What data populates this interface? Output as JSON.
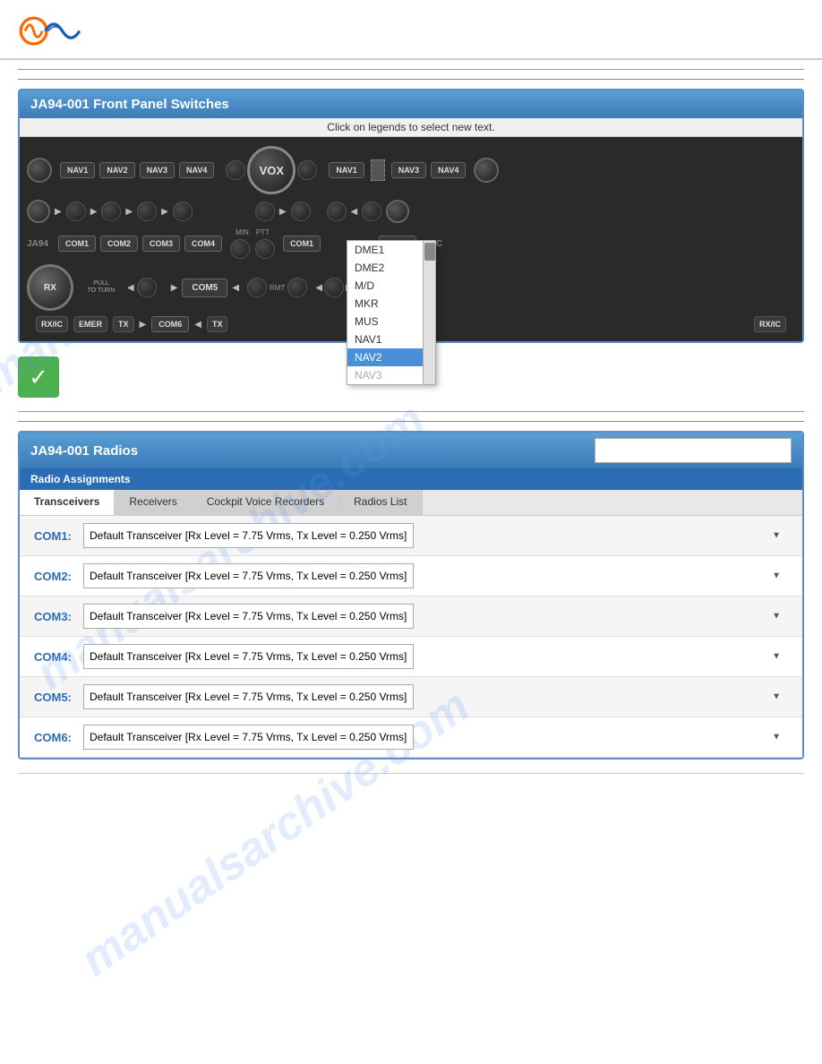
{
  "header": {
    "logo_alt": "Company Logo"
  },
  "panel1": {
    "title": "JA94-001 Front Panel Switches",
    "subtitle": "Click on legends to select new text.",
    "brand_left": "JA94",
    "brand_right": "JAC",
    "nav_buttons_top": [
      "NAV1",
      "NAV2",
      "NAV3",
      "NAV4",
      "NAV1",
      "NAV4"
    ],
    "com_buttons": [
      "COM1",
      "COM2",
      "COM3",
      "COM4",
      "COM1",
      "COM4"
    ],
    "bottom_buttons_left": [
      "RX/IC",
      "EMER",
      "TX",
      "COM6",
      "TX"
    ],
    "bottom_buttons_right": [
      "RX/IC"
    ],
    "vox_label": "VOX",
    "com5_label": "COM5",
    "rx_label": "RX",
    "pull_to_turn": "PULL\nTO TURN",
    "min_label": "MIN",
    "ptt_label": "PTT",
    "rmt_label": "RMT",
    "dropdown": {
      "items": [
        "DME1",
        "DME2",
        "M/D",
        "MKR",
        "MUS",
        "NAV1",
        "NAV2",
        "NAV3"
      ],
      "selected": "NAV2",
      "selected_index": 6
    }
  },
  "checkmark": {
    "symbol": "✓"
  },
  "panel2": {
    "title": "JA94-001 Radios",
    "assignments_label": "Radio Assignments",
    "tabs": [
      "Transceivers",
      "Receivers",
      "Cockpit Voice Recorders",
      "Radios List"
    ],
    "active_tab": 0,
    "com_labels": [
      "COM1:",
      "COM2:",
      "COM3:",
      "COM4:",
      "COM5:",
      "COM6:"
    ],
    "default_transceiver": "Default Transceiver  [Rx Level = 7.75 Vrms,  Tx Level = 0.250 Vrms]",
    "rows": [
      {
        "label": "COM1:",
        "value": "Default Transceiver  [Rx Level = 7.75 Vrms,  Tx Level = 0.250 Vrms]"
      },
      {
        "label": "COM2:",
        "value": "Default Transceiver  [Rx Level = 7.75 Vrms,  Tx Level = 0.250 Vrms]"
      },
      {
        "label": "COM3:",
        "value": "Default Transceiver  [Rx Level = 7.75 Vrms,  Tx Level = 0.250 Vrms]"
      },
      {
        "label": "COM4:",
        "value": "Default Transceiver  [Rx Level = 7.75 Vrms,  Tx Level = 0.250 Vrms]"
      },
      {
        "label": "COM5:",
        "value": "Default Transceiver  [Rx Level = 7.75 Vrms,  Tx Level = 0.250 Vrms]"
      },
      {
        "label": "COM6:",
        "value": "Default Transceiver  [Rx Level = 7.75 Vrms,  Tx Level = 0.250 Vrms]"
      }
    ]
  },
  "watermark_text": "manualsarchive.com"
}
